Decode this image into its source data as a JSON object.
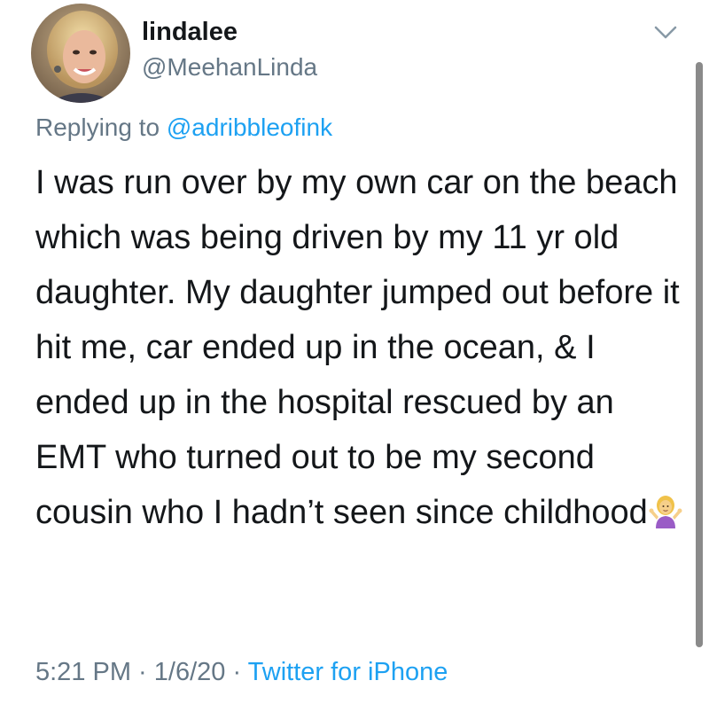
{
  "author": {
    "display_name": "lindalee",
    "handle": "@MeehanLinda"
  },
  "reply": {
    "prefix": "Replying to ",
    "mention": "@adribbleofink"
  },
  "tweet": {
    "text": "I was run over by my own car on the beach which was being driven by my 11 yr old daughter. My daughter jumped out before it hit me, car ended up in the ocean, & I ended up in the hospital rescued by an EMT who turned out to be my second cousin who I hadn’t seen since childhood",
    "emoji": "person-shrugging-emoji"
  },
  "meta": {
    "time": "5:21 PM",
    "sep1": " · ",
    "date": "1/6/20",
    "sep2": " · ",
    "source": "Twitter for iPhone"
  },
  "icons": {
    "menu": "chevron-down-icon"
  },
  "colors": {
    "text": "#14171a",
    "secondary": "#657786",
    "link": "#1da1f2"
  }
}
